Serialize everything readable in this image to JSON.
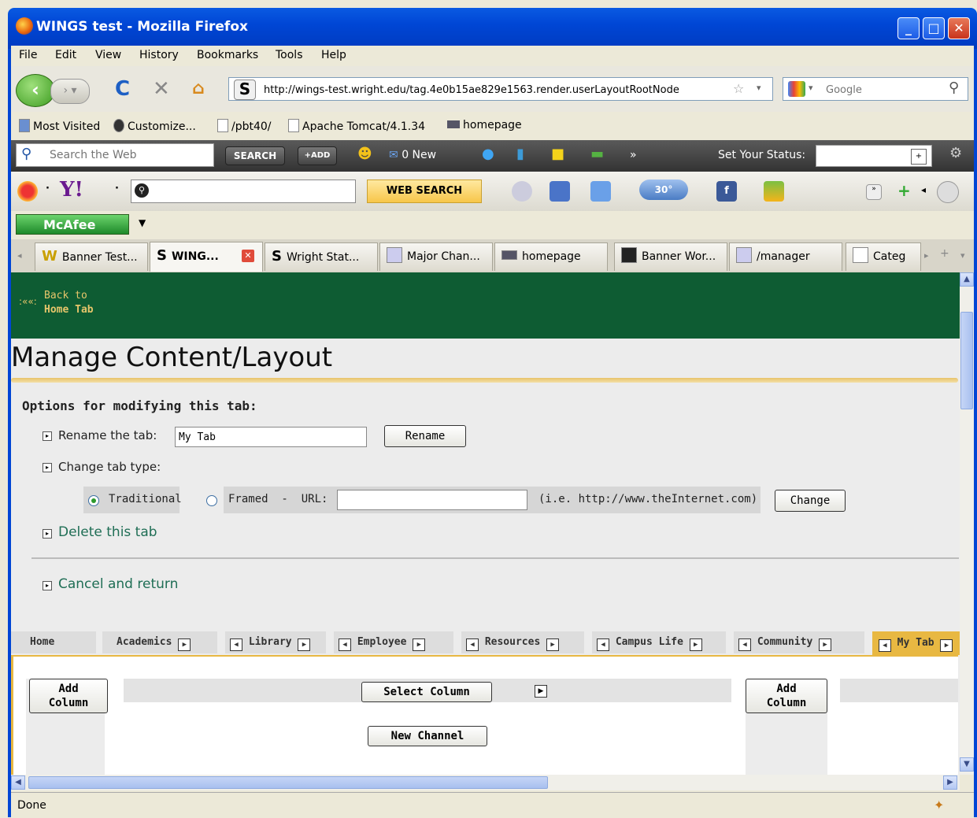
{
  "window": {
    "title": "WINGS test - Mozilla Firefox"
  },
  "menu": [
    "File",
    "Edit",
    "View",
    "History",
    "Bookmarks",
    "Tools",
    "Help"
  ],
  "nav": {
    "url": "http://wings-test.wright.edu/tag.4e0b15ae829e1563.render.userLayoutRootNode",
    "search_placeholder": "Google"
  },
  "bookmarks": [
    "Most Visited",
    "Customize...",
    "/pbt40/",
    "Apache Tomcat/4.1.34",
    "homepage"
  ],
  "webbar": {
    "search_placeholder": "Search the Web",
    "search_button": "SEARCH",
    "add_button": "+ADD",
    "mail": "0 New",
    "more": "»",
    "status_label": "Set Your Status:"
  },
  "yahoo": {
    "web_search": "WEB SEARCH",
    "weather": "30°"
  },
  "mcafee": {
    "label": "McAfee"
  },
  "browser_tabs": [
    "Banner Test...",
    "WING...",
    "Wright Stat...",
    "Major Chan...",
    "homepage",
    "Banner Wor...",
    "/manager",
    "Categ"
  ],
  "page": {
    "back_line1": "Back to",
    "back_line2": "Home Tab",
    "title": "Manage Content/Layout",
    "options_heading": "Options for modifying this tab:",
    "rename_label": "Rename the tab:",
    "rename_value": "My Tab",
    "rename_button": "Rename",
    "change_type_label": "Change tab type:",
    "traditional_label": "Traditional",
    "framed_label": "Framed  -  URL:",
    "url_hint": "(i.e. http://www.theInternet.com)",
    "change_button": "Change",
    "delete_link": "Delete this tab",
    "cancel_link": "Cancel and return"
  },
  "channel_tabs": [
    "Home",
    "Academics",
    "Library",
    "Employee",
    "Resources",
    "Campus Life",
    "Community",
    "My Tab"
  ],
  "layout": {
    "add_column_1": "Add",
    "add_column_2": "Column",
    "select_column": "Select Column",
    "new_channel": "New Channel"
  },
  "statusbar": {
    "text": "Done"
  }
}
